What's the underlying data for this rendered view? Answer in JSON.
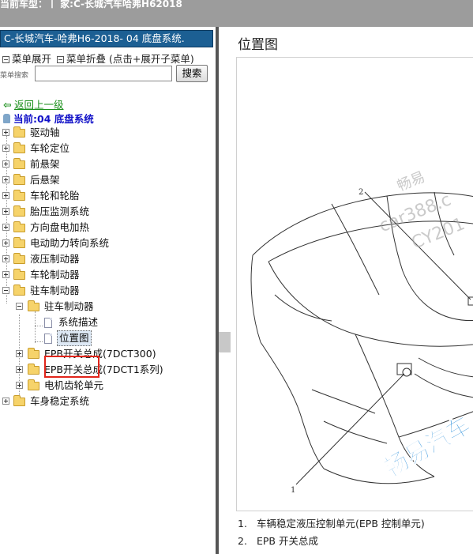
{
  "header": {
    "text": "当前车型：丨 家:C-长城汽车哈弗H62018"
  },
  "sidebar": {
    "title": "C-长城汽车-哈弗H6-2018- 04 底盘系统.",
    "menu_expand": "菜单展开",
    "menu_collapse": "菜单折叠 (点击+展开子菜单)",
    "search_label": "菜单搜索",
    "search_value": "",
    "search_button": "搜索",
    "back_link": "返回上一级",
    "current": "当前:04 底盘系统",
    "tree": [
      "驱动轴",
      "车轮定位",
      "前悬架",
      "后悬架",
      "车轮和轮胎",
      "胎压监测系统",
      "方向盘电加热",
      "电动助力转向系统",
      "液压制动器",
      "车轮制动器",
      "驻车制动器"
    ],
    "sub": {
      "parent": "驻车制动器",
      "docs": [
        "系统描述",
        "位置图"
      ],
      "folders": [
        "EPB开关总成(7DCT300)",
        "EPB开关总成(7DCT1系列)",
        "电机齿轮单元"
      ]
    },
    "last": "车身稳定系统"
  },
  "content": {
    "title": "位置图",
    "callouts": [
      "1",
      "2"
    ],
    "watermark": [
      "畅易",
      "car388.c",
      "CY201",
      "畅易汽车"
    ],
    "legend": [
      {
        "num": "1.",
        "text": "车辆稳定液压控制单元(EPB 控制单元)"
      },
      {
        "num": "2.",
        "text": "EPB 开关总成"
      }
    ]
  },
  "colors": {
    "titlebar": "#1c5f93",
    "back": "#1b8f1b",
    "current": "#1212c8",
    "highlight_box": "#e1251b",
    "watermark": "#1e88d8"
  }
}
